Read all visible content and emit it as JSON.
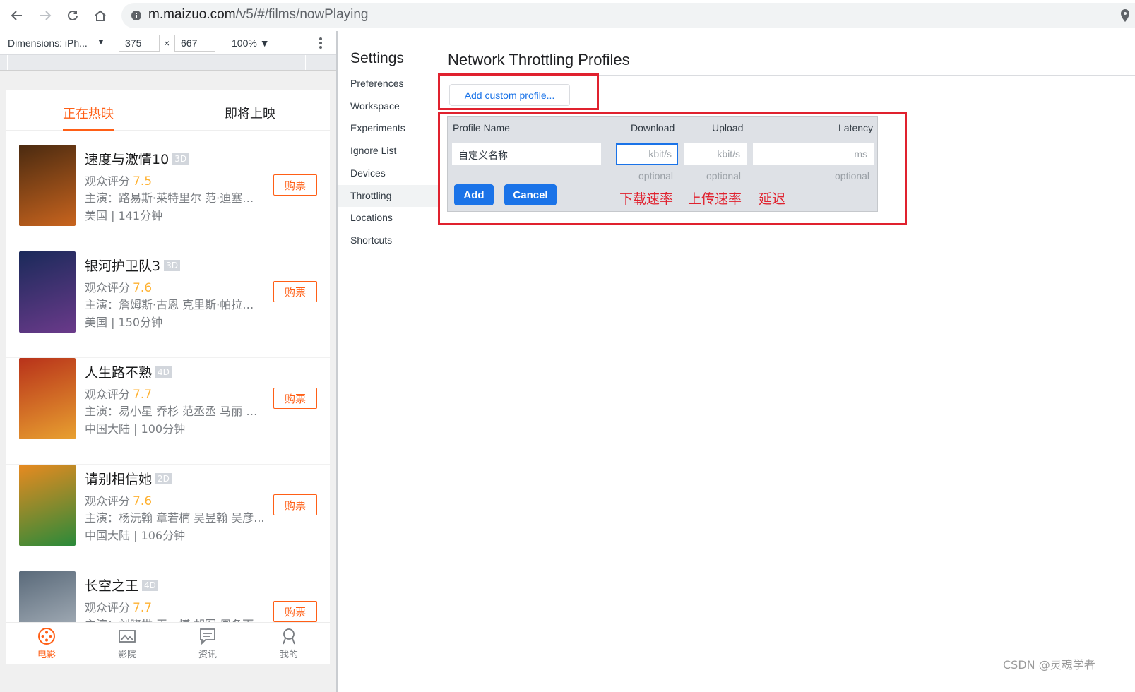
{
  "browser": {
    "url_host": "m.maizuo.com",
    "url_path": "/v5/#/films/nowPlaying"
  },
  "device_toolbar": {
    "dimensions_label": "Dimensions: iPh...",
    "width": "375",
    "height": "667",
    "zoom": "100%",
    "times": "×"
  },
  "mobile": {
    "tabs": [
      "正在热映",
      "即将上映"
    ],
    "movies": [
      {
        "title": "速度与激情10",
        "badge": "3D",
        "score_label": "观众评分",
        "score": "7.5",
        "actors": "主演：路易斯·莱特里尔 范·迪塞尔 ...",
        "info": "美国 | 141分钟",
        "buy": "购票",
        "poster_colors": [
          "#4a2a10",
          "#c8641e"
        ]
      },
      {
        "title": "银河护卫队3",
        "badge": "3D",
        "score_label": "观众评分",
        "score": "7.6",
        "actors": "主演：詹姆斯·古恩 克里斯·帕拉特 ...",
        "info": "美国 | 150分钟",
        "buy": "购票",
        "poster_colors": [
          "#1a2a5a",
          "#6a3a8a"
        ]
      },
      {
        "title": "人生路不熟",
        "badge": "4D",
        "score_label": "观众评分",
        "score": "7.7",
        "actors": "主演：易小星 乔杉 范丞丞 马丽 张...",
        "info": "中国大陆 | 100分钟",
        "buy": "购票",
        "poster_colors": [
          "#b8321a",
          "#e8a030"
        ]
      },
      {
        "title": "请别相信她",
        "badge": "2D",
        "score_label": "观众评分",
        "score": "7.6",
        "actors": "主演：杨沅翰 章若楠 吴昱翰 吴彦...",
        "info": "中国大陆 | 106分钟",
        "buy": "购票",
        "poster_colors": [
          "#e88a20",
          "#2a8a3a"
        ]
      },
      {
        "title": "长空之王",
        "badge": "4D",
        "score_label": "观众评分",
        "score": "7.7",
        "actors": "主演：刘晓世 王一博 胡军 周冬雨",
        "info": "",
        "buy": "购票",
        "poster_colors": [
          "#5a6a7a",
          "#b8c0c8"
        ]
      }
    ],
    "bottom_nav": [
      "电影",
      "影院",
      "资讯",
      "我的"
    ]
  },
  "settings": {
    "title": "Settings",
    "items": [
      "Preferences",
      "Workspace",
      "Experiments",
      "Ignore List",
      "Devices",
      "Throttling",
      "Locations",
      "Shortcuts"
    ],
    "selected": "Throttling"
  },
  "throttling": {
    "title": "Network Throttling Profiles",
    "add_button": "Add custom profile...",
    "columns": {
      "name": "Profile Name",
      "download": "Download",
      "upload": "Upload",
      "latency": "Latency"
    },
    "inputs": {
      "name_value": "自定义名称",
      "download_ph": "kbit/s",
      "upload_ph": "kbit/s",
      "latency_ph": "ms"
    },
    "optional": "optional",
    "add": "Add",
    "cancel": "Cancel"
  },
  "annotations": [
    "下载速率",
    "上传速率",
    "延迟"
  ],
  "watermark": "CSDN @灵魂学者",
  "colors": {
    "accent": "#ff5f16",
    "annotation_red": "#e0212e",
    "devtools_blue": "#1a73e8"
  }
}
